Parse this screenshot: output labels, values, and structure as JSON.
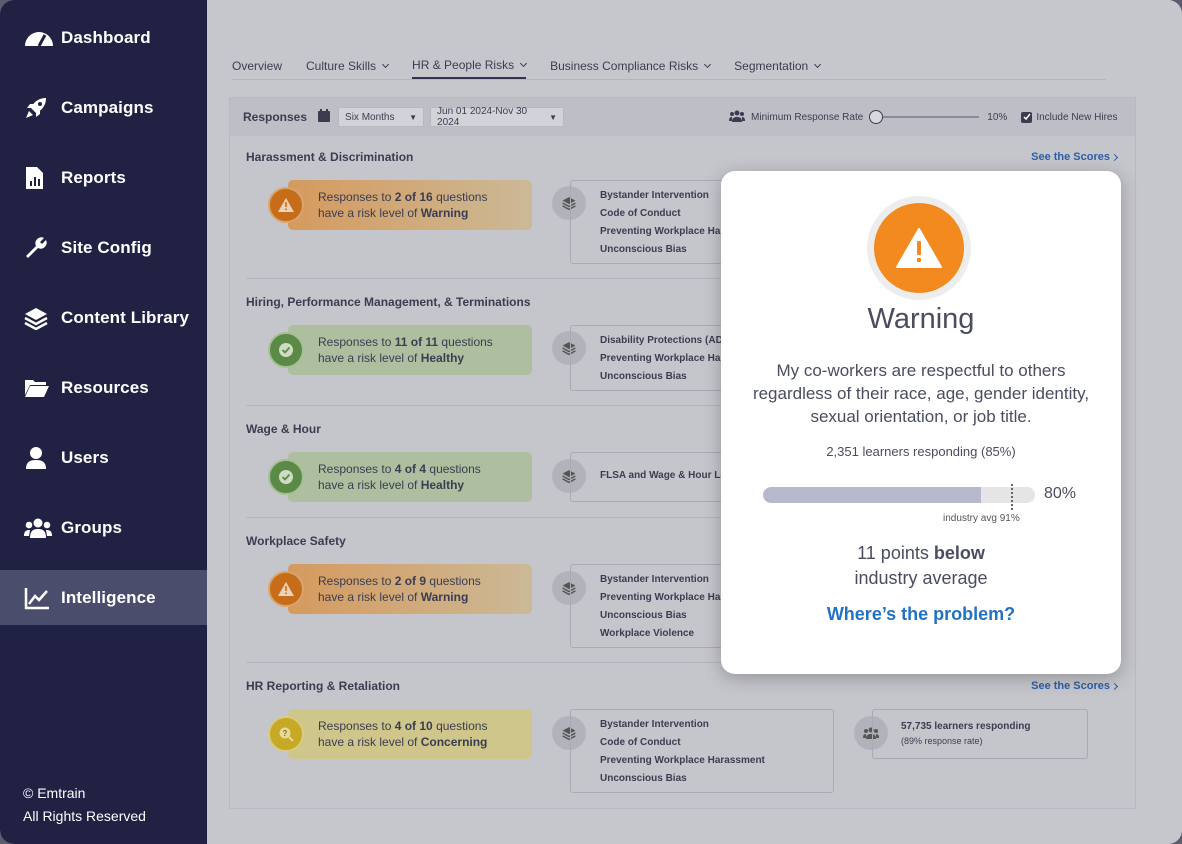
{
  "sidebar": {
    "items": [
      {
        "label": "Dashboard",
        "icon": "gauge-icon"
      },
      {
        "label": "Campaigns",
        "icon": "rocket-icon"
      },
      {
        "label": "Reports",
        "icon": "report-icon"
      },
      {
        "label": "Site Config",
        "icon": "wrench-icon"
      },
      {
        "label": "Content Library",
        "icon": "layers-icon"
      },
      {
        "label": "Resources",
        "icon": "folder-icon"
      },
      {
        "label": "Users",
        "icon": "user-icon"
      },
      {
        "label": "Groups",
        "icon": "group-icon"
      },
      {
        "label": "Intelligence",
        "icon": "chart-line-icon",
        "active": true
      }
    ],
    "footer": {
      "line1": "© Emtrain",
      "line2": "All Rights Reserved"
    }
  },
  "tabs": [
    "Overview",
    "Culture Skills",
    "HR & People Risks",
    "Business Compliance Risks",
    "Segmentation"
  ],
  "active_tab": "HR & People Risks",
  "toolbar": {
    "label": "Responses",
    "period": "Six Months",
    "date_range": "Jun 01 2024-Nov 30 2024",
    "min_rate_label": "Minimum Response Rate",
    "min_rate_value": "10%",
    "include_label": "Include New Hires",
    "include_checked": true
  },
  "sections": [
    {
      "title": "Harassment & Discrimination",
      "see": "See the Scores",
      "risk": "warn",
      "line1_pre": "Responses to ",
      "line1_b": "2 of 16",
      "line1_post": " questions",
      "line2_pre": "have a risk level of ",
      "line2_b": "Warning",
      "topics": [
        "Bystander Intervention",
        "Code of Conduct",
        "Preventing Workplace Harassment",
        "Unconscious Bias"
      ]
    },
    {
      "title": "Hiring, Performance Management, & Terminations",
      "see": "",
      "risk": "ok",
      "line1_pre": "Responses to ",
      "line1_b": "11 of 11",
      "line1_post": " questions",
      "line2_pre": "have a risk level of ",
      "line2_b": "Healthy",
      "topics": [
        "Disability Protections (ADA)",
        "Preventing Workplace Harassment",
        "Unconscious Bias"
      ]
    },
    {
      "title": "Wage & Hour",
      "see": "",
      "risk": "ok",
      "line1_pre": "Responses to ",
      "line1_b": "4 of 4",
      "line1_post": " questions",
      "line2_pre": "have a risk level of ",
      "line2_b": "Healthy",
      "topics": [
        "FLSA and Wage & Hour Law"
      ]
    },
    {
      "title": "Workplace Safety",
      "see": "",
      "risk": "warn",
      "line1_pre": "Responses to ",
      "line1_b": "2 of 9",
      "line1_post": " questions",
      "line2_pre": "have a risk level of ",
      "line2_b": "Warning",
      "topics": [
        "Bystander Intervention",
        "Preventing Workplace Harassment",
        "Unconscious Bias",
        "Workplace Violence"
      ]
    },
    {
      "title": "HR Reporting & Retaliation",
      "see": "See the Scores",
      "risk": "conc",
      "line1_pre": "Responses to ",
      "line1_b": "4 of 10",
      "line1_post": " questions",
      "line2_pre": "have a risk level of ",
      "line2_b": "Concerning",
      "topics": [
        "Bystander Intervention",
        "Code of Conduct",
        "Preventing Workplace Harassment",
        "Unconscious Bias"
      ],
      "responding": "57,735 learners responding",
      "response_rate": "(89% response rate)"
    }
  ],
  "card": {
    "title": "Warning",
    "question": "My co-workers are respectful to others regardless of their race, age, gender identity, sexual orientation, or job title.",
    "count": "2,351 learners responding (85%)",
    "score": 80,
    "score_label": "80%",
    "industry_avg": 91,
    "industry_label": "industry avg 91%",
    "points_pre": "11 points ",
    "points_b": "below",
    "points_post": "industry average",
    "link": "Where’s the problem?",
    "accent": "#f28a1f"
  }
}
